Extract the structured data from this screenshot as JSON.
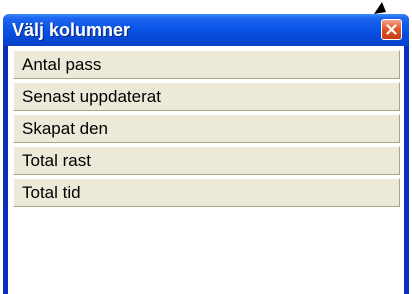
{
  "dialog": {
    "title": "Välj kolumner",
    "close_icon": "close-icon",
    "items": [
      {
        "label": "Antal pass"
      },
      {
        "label": "Senast uppdaterat"
      },
      {
        "label": "Skapat den"
      },
      {
        "label": "Total rast"
      },
      {
        "label": "Total tid"
      }
    ]
  },
  "colors": {
    "titlebar": "#0a55e8",
    "close_button": "#e2572e",
    "item_background": "#ece9d8"
  }
}
